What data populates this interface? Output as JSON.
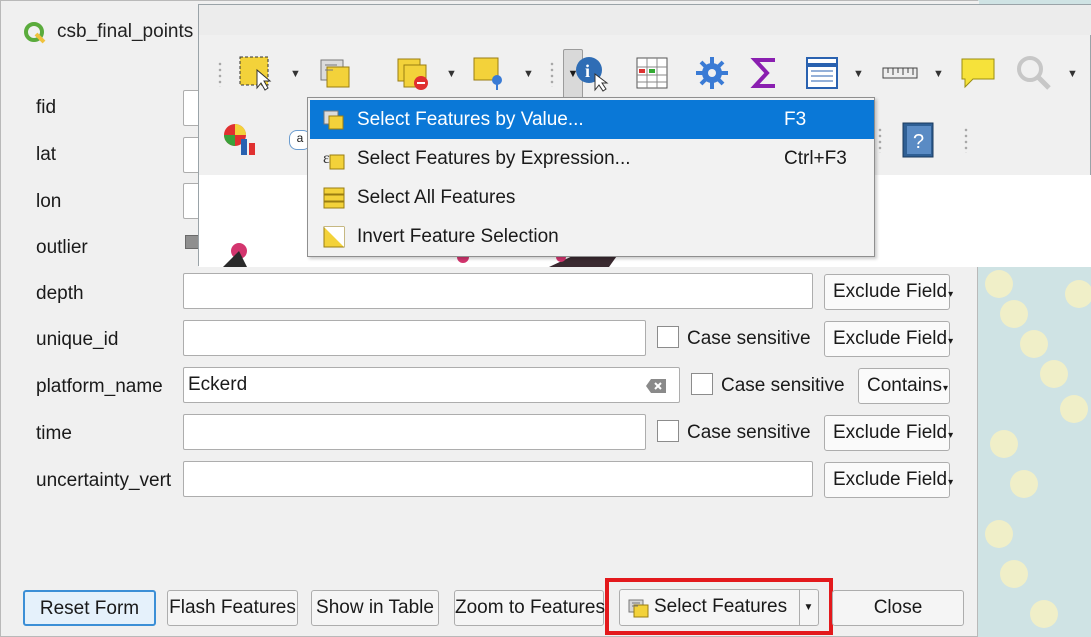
{
  "dialog": {
    "title": "csb_final_points"
  },
  "fields": [
    {
      "label": "fid",
      "value": ""
    },
    {
      "label": "lat",
      "value": ""
    },
    {
      "label": "lon",
      "value": ""
    },
    {
      "label": "outlier",
      "value": ""
    },
    {
      "label": "depth",
      "value": "",
      "option": "Exclude Field"
    },
    {
      "label": "unique_id",
      "value": "",
      "case_label": "Case sensitive",
      "option": "Exclude Field"
    },
    {
      "label": "platform_name",
      "value": "Eckerd",
      "case_label": "Case sensitive",
      "option": "Contains"
    },
    {
      "label": "time",
      "value": "",
      "case_label": "Case sensitive",
      "option": "Exclude Field"
    },
    {
      "label": "uncertainty_vert",
      "value": "",
      "option": "Exclude Field"
    }
  ],
  "buttons": {
    "reset": "Reset Form",
    "flash": "Flash Features",
    "show_table": "Show in Table",
    "zoom": "Zoom to Features",
    "select": "Select Features",
    "close": "Close"
  },
  "menu": {
    "items": [
      {
        "label": "Select Features by Value...",
        "shortcut": "F3",
        "icon": "select-by-value-icon",
        "active": true
      },
      {
        "label": "Select Features by Expression...",
        "shortcut": "Ctrl+F3",
        "icon": "expression-icon",
        "active": false
      },
      {
        "label": "Select All Features",
        "shortcut": "",
        "icon": "select-all-icon",
        "active": false
      },
      {
        "label": "Invert Feature Selection",
        "shortcut": "",
        "icon": "invert-selection-icon",
        "active": false
      }
    ]
  },
  "colors": {
    "highlight": "#0a78d7",
    "red_outline": "#e3191c",
    "dialog_bg": "#f0f0f0"
  }
}
